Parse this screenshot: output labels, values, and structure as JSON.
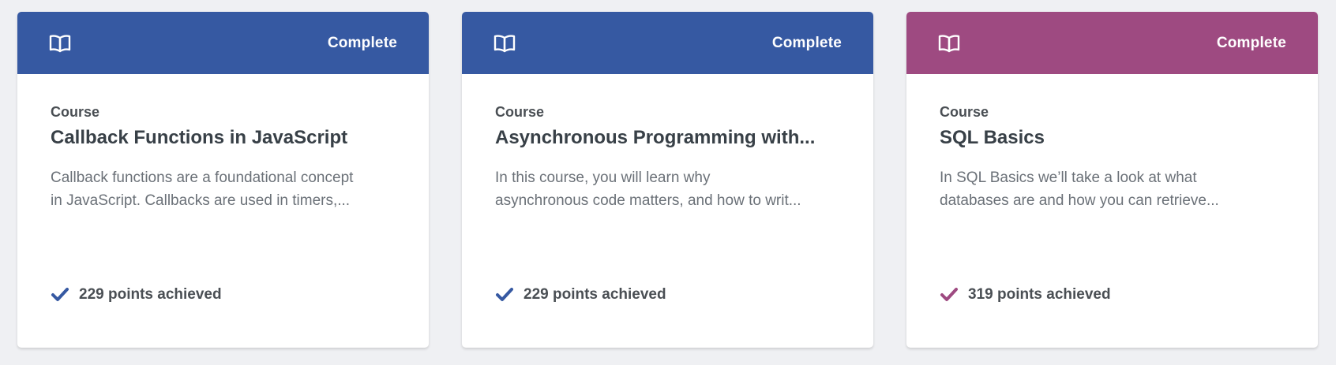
{
  "cards": [
    {
      "accent": "#3659a2",
      "header": {
        "icon": "book-icon",
        "status": "Complete"
      },
      "eyebrow": "Course",
      "title": "Callback Functions in JavaScript",
      "description_lines": [
        "Callback functions are a foundational concept",
        "in JavaScript. Callbacks are used in timers,..."
      ],
      "points": {
        "icon": "checkmark-icon",
        "text": "229 points achieved"
      }
    },
    {
      "accent": "#3659a2",
      "header": {
        "icon": "book-icon",
        "status": "Complete"
      },
      "eyebrow": "Course",
      "title": "Asynchronous Programming with...",
      "description_lines": [
        "In this course, you will learn why",
        "asynchronous code matters, and how to writ..."
      ],
      "points": {
        "icon": "checkmark-icon",
        "text": "229 points achieved"
      }
    },
    {
      "accent": "#9e4a81",
      "header": {
        "icon": "book-icon",
        "status": "Complete"
      },
      "eyebrow": "Course",
      "title": "SQL Basics",
      "description_lines": [
        "In SQL Basics we’ll take a look at what",
        "databases are and how you can retrieve..."
      ],
      "points": {
        "icon": "checkmark-icon",
        "text": "319 points achieved"
      }
    }
  ]
}
